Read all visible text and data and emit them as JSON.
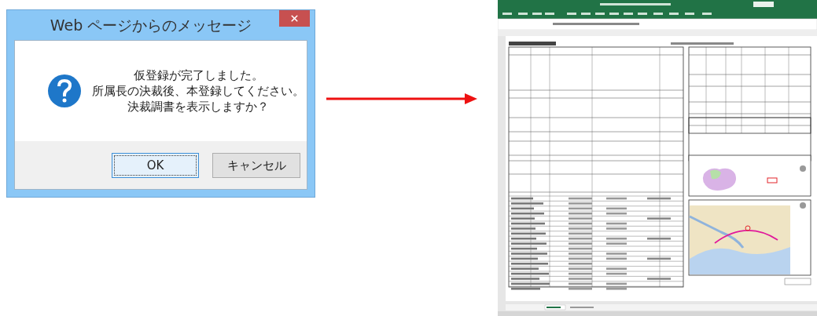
{
  "dialog": {
    "title": "Web ページからのメッセージ",
    "message": [
      "仮登録が完了しました。",
      "所属長の決裁後、本登録してください。",
      "決裁調書を表示しますか？"
    ],
    "buttons": [
      {
        "label": "OK",
        "focused": true
      },
      {
        "label": "キャンセル",
        "focused": false
      }
    ]
  }
}
